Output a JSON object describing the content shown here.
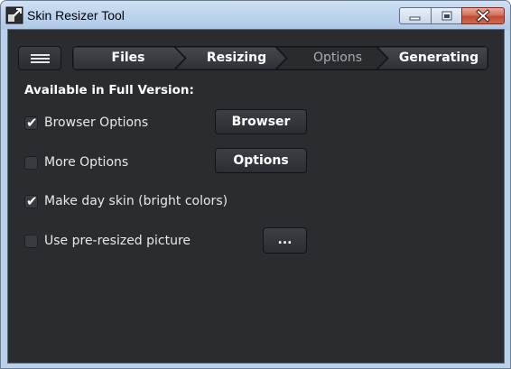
{
  "window": {
    "title": "Skin Resizer Tool",
    "icon": "resize-icon"
  },
  "controls": {
    "minimize": "minimize-icon",
    "maximize": "maximize-icon",
    "close": "close-icon"
  },
  "steps": [
    {
      "label": "Files",
      "active": true
    },
    {
      "label": "Resizing",
      "active": true
    },
    {
      "label": "Options",
      "active": false
    },
    {
      "label": "Generating",
      "active": true
    }
  ],
  "section": {
    "title": "Available in Full Version:"
  },
  "options": [
    {
      "label": "Browser Options",
      "checked": true
    },
    {
      "label": "More Options",
      "checked": false
    },
    {
      "label": "Make day skin (bright colors)",
      "checked": true
    },
    {
      "label": "Use pre-resized picture",
      "checked": false
    }
  ],
  "buttons": {
    "browser": "Browser",
    "options": "Options",
    "browse": "..."
  },
  "colors": {
    "background": "#2b2c30",
    "text": "#ffffff",
    "inactive_step": "#a9abb0"
  }
}
